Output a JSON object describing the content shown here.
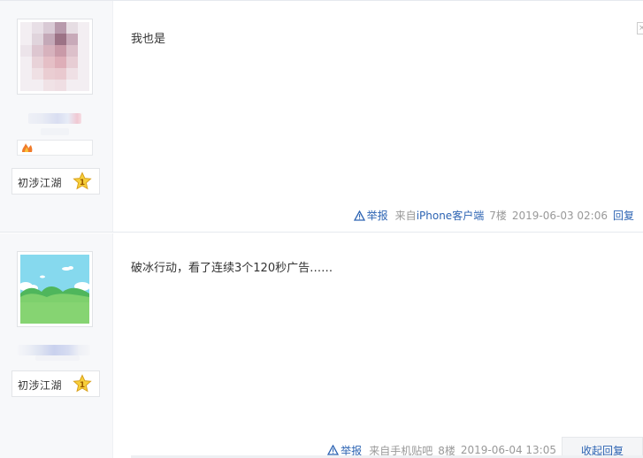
{
  "posts": [
    {
      "content": "我也是",
      "level_label": "初涉江湖",
      "level_number": "1",
      "report_label": "举报",
      "from_prefix": "来自",
      "from_client": "iPhone客户端",
      "floor": "7楼",
      "time": "2019-06-03 02:06",
      "reply_label": "回复"
    },
    {
      "content": "破冰行动，看了连续3个120秒广告……",
      "level_label": "初涉江湖",
      "level_number": "1",
      "report_label": "举报",
      "from_prefix": "来自",
      "from_client": "手机贴吧",
      "floor": "8楼",
      "time": "2019-06-04 13:05",
      "reply_label": "收起回复"
    }
  ],
  "colors": {
    "link": "#2d64b3",
    "meta": "#999999",
    "sidebar_bg": "#f7f8fa",
    "star": "#f5c518"
  },
  "icons": {
    "report": "warning-triangle-icon",
    "level_badge": "star-icon"
  }
}
